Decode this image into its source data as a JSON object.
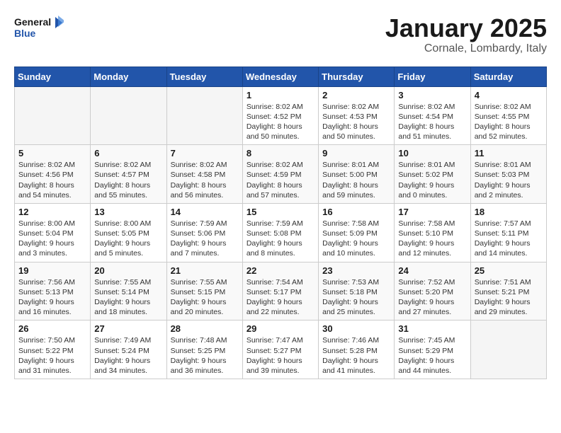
{
  "logo": {
    "line1": "General",
    "line2": "Blue"
  },
  "title": "January 2025",
  "subtitle": "Cornale, Lombardy, Italy",
  "weekdays": [
    "Sunday",
    "Monday",
    "Tuesday",
    "Wednesday",
    "Thursday",
    "Friday",
    "Saturday"
  ],
  "weeks": [
    [
      {
        "day": "",
        "info": ""
      },
      {
        "day": "",
        "info": ""
      },
      {
        "day": "",
        "info": ""
      },
      {
        "day": "1",
        "info": "Sunrise: 8:02 AM\nSunset: 4:52 PM\nDaylight: 8 hours\nand 50 minutes."
      },
      {
        "day": "2",
        "info": "Sunrise: 8:02 AM\nSunset: 4:53 PM\nDaylight: 8 hours\nand 50 minutes."
      },
      {
        "day": "3",
        "info": "Sunrise: 8:02 AM\nSunset: 4:54 PM\nDaylight: 8 hours\nand 51 minutes."
      },
      {
        "day": "4",
        "info": "Sunrise: 8:02 AM\nSunset: 4:55 PM\nDaylight: 8 hours\nand 52 minutes."
      }
    ],
    [
      {
        "day": "5",
        "info": "Sunrise: 8:02 AM\nSunset: 4:56 PM\nDaylight: 8 hours\nand 54 minutes."
      },
      {
        "day": "6",
        "info": "Sunrise: 8:02 AM\nSunset: 4:57 PM\nDaylight: 8 hours\nand 55 minutes."
      },
      {
        "day": "7",
        "info": "Sunrise: 8:02 AM\nSunset: 4:58 PM\nDaylight: 8 hours\nand 56 minutes."
      },
      {
        "day": "8",
        "info": "Sunrise: 8:02 AM\nSunset: 4:59 PM\nDaylight: 8 hours\nand 57 minutes."
      },
      {
        "day": "9",
        "info": "Sunrise: 8:01 AM\nSunset: 5:00 PM\nDaylight: 8 hours\nand 59 minutes."
      },
      {
        "day": "10",
        "info": "Sunrise: 8:01 AM\nSunset: 5:02 PM\nDaylight: 9 hours\nand 0 minutes."
      },
      {
        "day": "11",
        "info": "Sunrise: 8:01 AM\nSunset: 5:03 PM\nDaylight: 9 hours\nand 2 minutes."
      }
    ],
    [
      {
        "day": "12",
        "info": "Sunrise: 8:00 AM\nSunset: 5:04 PM\nDaylight: 9 hours\nand 3 minutes."
      },
      {
        "day": "13",
        "info": "Sunrise: 8:00 AM\nSunset: 5:05 PM\nDaylight: 9 hours\nand 5 minutes."
      },
      {
        "day": "14",
        "info": "Sunrise: 7:59 AM\nSunset: 5:06 PM\nDaylight: 9 hours\nand 7 minutes."
      },
      {
        "day": "15",
        "info": "Sunrise: 7:59 AM\nSunset: 5:08 PM\nDaylight: 9 hours\nand 8 minutes."
      },
      {
        "day": "16",
        "info": "Sunrise: 7:58 AM\nSunset: 5:09 PM\nDaylight: 9 hours\nand 10 minutes."
      },
      {
        "day": "17",
        "info": "Sunrise: 7:58 AM\nSunset: 5:10 PM\nDaylight: 9 hours\nand 12 minutes."
      },
      {
        "day": "18",
        "info": "Sunrise: 7:57 AM\nSunset: 5:11 PM\nDaylight: 9 hours\nand 14 minutes."
      }
    ],
    [
      {
        "day": "19",
        "info": "Sunrise: 7:56 AM\nSunset: 5:13 PM\nDaylight: 9 hours\nand 16 minutes."
      },
      {
        "day": "20",
        "info": "Sunrise: 7:55 AM\nSunset: 5:14 PM\nDaylight: 9 hours\nand 18 minutes."
      },
      {
        "day": "21",
        "info": "Sunrise: 7:55 AM\nSunset: 5:15 PM\nDaylight: 9 hours\nand 20 minutes."
      },
      {
        "day": "22",
        "info": "Sunrise: 7:54 AM\nSunset: 5:17 PM\nDaylight: 9 hours\nand 22 minutes."
      },
      {
        "day": "23",
        "info": "Sunrise: 7:53 AM\nSunset: 5:18 PM\nDaylight: 9 hours\nand 25 minutes."
      },
      {
        "day": "24",
        "info": "Sunrise: 7:52 AM\nSunset: 5:20 PM\nDaylight: 9 hours\nand 27 minutes."
      },
      {
        "day": "25",
        "info": "Sunrise: 7:51 AM\nSunset: 5:21 PM\nDaylight: 9 hours\nand 29 minutes."
      }
    ],
    [
      {
        "day": "26",
        "info": "Sunrise: 7:50 AM\nSunset: 5:22 PM\nDaylight: 9 hours\nand 31 minutes."
      },
      {
        "day": "27",
        "info": "Sunrise: 7:49 AM\nSunset: 5:24 PM\nDaylight: 9 hours\nand 34 minutes."
      },
      {
        "day": "28",
        "info": "Sunrise: 7:48 AM\nSunset: 5:25 PM\nDaylight: 9 hours\nand 36 minutes."
      },
      {
        "day": "29",
        "info": "Sunrise: 7:47 AM\nSunset: 5:27 PM\nDaylight: 9 hours\nand 39 minutes."
      },
      {
        "day": "30",
        "info": "Sunrise: 7:46 AM\nSunset: 5:28 PM\nDaylight: 9 hours\nand 41 minutes."
      },
      {
        "day": "31",
        "info": "Sunrise: 7:45 AM\nSunset: 5:29 PM\nDaylight: 9 hours\nand 44 minutes."
      },
      {
        "day": "",
        "info": ""
      }
    ]
  ]
}
